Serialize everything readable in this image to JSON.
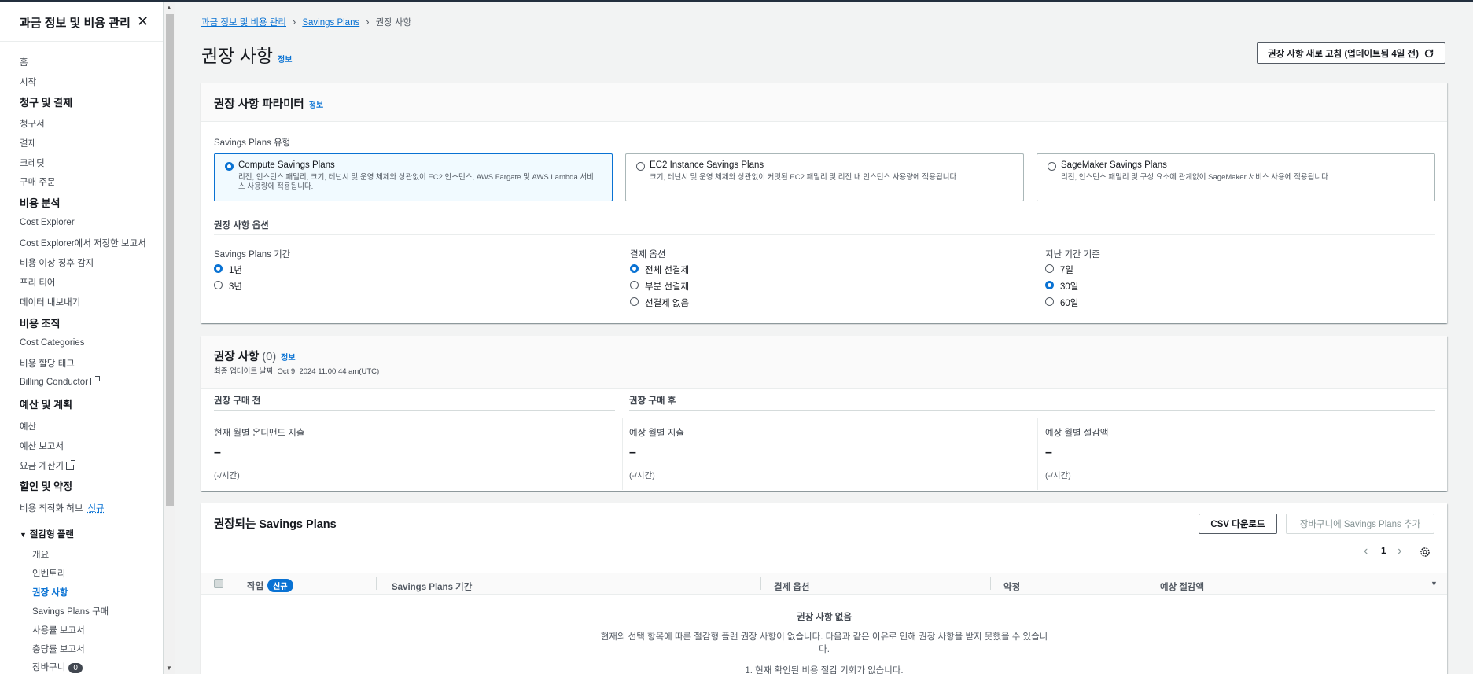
{
  "sidebar": {
    "title": "과금 정보 및 비용 관리",
    "items_top": [
      "홈",
      "시작"
    ],
    "sections": [
      {
        "title": "청구 및 결제",
        "items": [
          "청구서",
          "결제",
          "크레딧",
          "구매 주문"
        ]
      },
      {
        "title": "비용 분석",
        "items": [
          "Cost Explorer",
          "Cost Explorer에서 저장한 보고서",
          "비용 이상 징후 감지",
          "프리 티어",
          "데이터 내보내기"
        ]
      },
      {
        "title": "비용 조직",
        "items": [
          "Cost Categories",
          "비용 할당 태그",
          "Billing Conductor"
        ]
      },
      {
        "title": "예산 및 계획",
        "items": [
          "예산",
          "예산 보고서",
          "요금 계산기"
        ]
      },
      {
        "title": "할인 및 약정",
        "items": [
          "비용 최적화 허브"
        ]
      }
    ],
    "new_label": "신규",
    "group": {
      "title": "절감형 플랜",
      "items": [
        "개요",
        "인벤토리",
        "권장 사항",
        "Savings Plans 구매",
        "사용률 보고서",
        "충당률 보고서",
        "장바구니"
      ]
    },
    "cart_count": "0"
  },
  "breadcrumb": [
    "과금 정보 및 비용 관리",
    "Savings Plans",
    "권장 사항"
  ],
  "page": {
    "title": "권장 사항",
    "info": "정보",
    "refresh_button": "권장 사항 새로 고침 (업데이트됨 4일 전)"
  },
  "params": {
    "title": "권장 사항 파라미터",
    "info": "정보",
    "type_label": "Savings Plans 유형",
    "types": [
      {
        "title": "Compute Savings Plans",
        "desc": "리전, 인스턴스 패밀리, 크기, 테넌시 및 운영 체제와 상관없이 EC2 인스턴스, AWS Fargate 및 AWS Lambda 서비스 사용량에 적용됩니다.",
        "selected": true
      },
      {
        "title": "EC2 Instance Savings Plans",
        "desc": "크기, 테넌시 및 운영 체제와 상관없이 커밋된 EC2 패밀리 및 리전 내 인스턴스 사용량에 적용됩니다.",
        "selected": false
      },
      {
        "title": "SageMaker Savings Plans",
        "desc": "리전, 인스턴스 패밀리 및 구성 요소에 관계없이 SageMaker 서비스 사용에 적용됩니다.",
        "selected": false
      }
    ],
    "options_title": "권장 사항 옵션",
    "term": {
      "label": "Savings Plans 기간",
      "options": [
        "1년",
        "3년"
      ],
      "selected": 0
    },
    "payment": {
      "label": "결제 옵션",
      "options": [
        "전체 선결제",
        "부분 선결제",
        "선결제 없음"
      ],
      "selected": 0
    },
    "lookback": {
      "label": "지난 기간 기준",
      "options": [
        "7일",
        "30일",
        "60일"
      ],
      "selected": 1
    }
  },
  "recommendations": {
    "title": "권장 사항",
    "count": "(0)",
    "info": "정보",
    "updated": "최종 업데이트 날짜: Oct 9, 2024 11:00:44 am(UTC)",
    "before_label": "권장 구매 전",
    "after_label": "권장 구매 후",
    "metrics": [
      {
        "label": "현재 월별 온디맨드 지출",
        "value": "–",
        "unit": "(-/시간)"
      },
      {
        "label": "예상 월별 지출",
        "value": "–",
        "unit": "(-/시간)"
      },
      {
        "label": "예상 월별 절감액",
        "value": "–",
        "unit": "(-/시간)"
      }
    ]
  },
  "table": {
    "title": "권장되는 Savings Plans",
    "csv_button": "CSV 다운로드",
    "add_cart_button": "장바구니에 Savings Plans 추가",
    "page_number": "1",
    "columns": [
      "작업",
      "Savings Plans 기간",
      "결제 옵션",
      "약정",
      "예상 절감액"
    ],
    "new_badge": "신규",
    "empty_title": "권장 사항 없음",
    "empty_line1": "현재의 선택 항목에 따른 절감형 플랜 권장 사항이 없습니다. 다음과 같은 이유로 인해 권장 사항을 받지 못했을 수 있습니",
    "empty_line2": "다.",
    "empty_reason1": "1. 현재 확인된 비용 절감 기회가 없습니다."
  },
  "colors": {
    "accent": "#0972d3",
    "text": "#16191f",
    "muted": "#545b64",
    "background": "#f2f3f3"
  }
}
